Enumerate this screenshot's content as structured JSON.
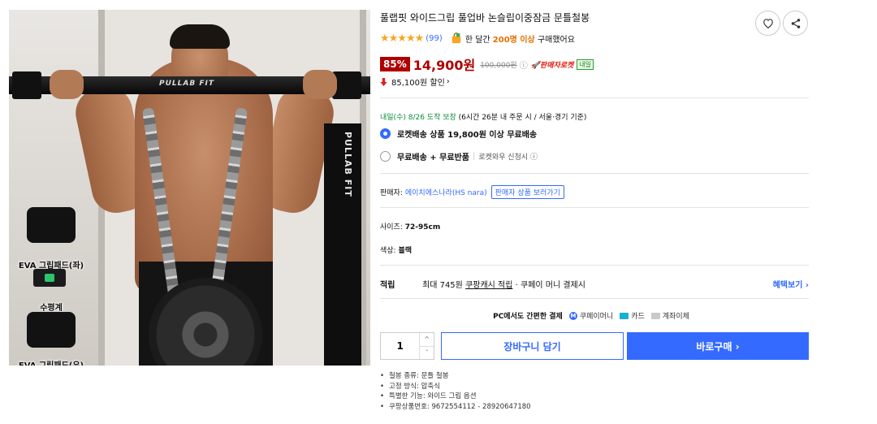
{
  "product": {
    "title": "풀랩핏 와이드그립 풀업바 논슬립이중잠금 문틀철봉",
    "image": {
      "bar_brand": "PULLAB FIT",
      "box_brand": "PULLAB FIT",
      "accessories": [
        "EVA 그립패드(좌)",
        "수평계",
        "EVA 그립패드(우)"
      ]
    }
  },
  "rating": {
    "stars": "★★★★★",
    "review_count": "(99)",
    "monthly_purchase_prefix": "한 달간",
    "monthly_purchase_strong": "200명 이상",
    "monthly_purchase_suffix": "구매했어요"
  },
  "price": {
    "discount_rate": "85%",
    "sale_price": "14,900원",
    "original_price": "100,000원",
    "info_icon": "ⓘ",
    "rocket_label": "🚀판매자로켓",
    "tomorrow_tag": "내일",
    "save_amount": "85,100원 할인",
    "save_chevron": "›"
  },
  "delivery": {
    "arrival_green": "내일(수) 8/26 도착 보장",
    "arrival_note": "(6시간 26분 내 주문 시 / 서울·경기 기준)",
    "option1": "로켓배송 상품 19,800원 이상 무료배송",
    "option2_bold": "무료배송 + 무료반품",
    "option2_sep": "|",
    "option2_note": "로켓와우 신청시 ⓘ"
  },
  "seller": {
    "label": "판매자:",
    "name": "에이치에스나라(HS nara)",
    "button": "판매자 상품 보러가기"
  },
  "options": {
    "size_label": "사이즈:",
    "size_value": "72-95cm",
    "color_label": "색상:",
    "color_value": "블랙"
  },
  "reward": {
    "label": "적립",
    "text_prefix": "최대 745원",
    "text_link": "쿠팡캐시 적립",
    "text_suffix": "· 쿠페이 머니 결제시",
    "more": "혜택보기 ›"
  },
  "payment": {
    "title": "PC에서도 간편한 결제",
    "coupay": "쿠페이머니",
    "coupay_badge": "M",
    "card": "카드",
    "bank": "계좌이체"
  },
  "purchase": {
    "quantity": "1",
    "up": "^",
    "down": "ˇ",
    "cart_label": "장바구니 담기",
    "buy_label": "바로구매 ›"
  },
  "specs": [
    "철봉 종류: 문틀 철봉",
    "고정 방식: 압축식",
    "특별한 기능: 와이드 그립 옵션",
    "쿠팡상품번호: 9672554112 - 28920647180"
  ],
  "colors": {
    "accent_blue": "#346aff",
    "discount_red": "#ae0000",
    "star_orange": "#f6a623",
    "delivery_green": "#0a8a3a"
  }
}
